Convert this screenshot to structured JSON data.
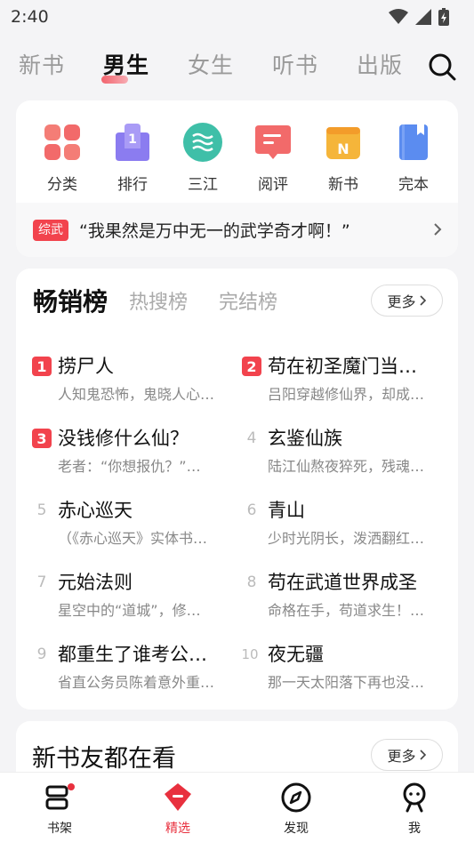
{
  "status": {
    "time": "2:40"
  },
  "top_tabs": [
    {
      "label": "新书"
    },
    {
      "label": "男生"
    },
    {
      "label": "女生"
    },
    {
      "label": "听书"
    },
    {
      "label": "出版"
    }
  ],
  "categories": [
    {
      "label": "分类",
      "icon": "grid-icon",
      "color": "#f26a6a"
    },
    {
      "label": "排行",
      "icon": "rank-icon",
      "color": "#8b7cf0"
    },
    {
      "label": "三江",
      "icon": "river-icon",
      "color": "#3fbfa8"
    },
    {
      "label": "阅评",
      "icon": "comment-icon",
      "color": "#f26a6a"
    },
    {
      "label": "新书",
      "icon": "new-book-icon",
      "color": "#f5b53a"
    },
    {
      "label": "完本",
      "icon": "finished-book-icon",
      "color": "#5b8cf0"
    }
  ],
  "quote": {
    "badge": "综武",
    "text": "“我果然是万中无一的武学奇才啊！”"
  },
  "ranking": {
    "tabs": [
      {
        "label": "畅销榜"
      },
      {
        "label": "热搜榜"
      },
      {
        "label": "完结榜"
      }
    ],
    "more_label": "更多",
    "items": [
      {
        "rank": "1",
        "title": "捞尸人",
        "desc": "人知鬼恐怖，鬼晓人心…"
      },
      {
        "rank": "2",
        "title": "苟在初圣魔门当…",
        "desc": "吕阳穿越修仙界，却成…"
      },
      {
        "rank": "3",
        "title": "没钱修什么仙？",
        "desc": "老者：“你想报仇？”…"
      },
      {
        "rank": "4",
        "title": "玄鉴仙族",
        "desc": "陆江仙熬夜猝死，残魂…"
      },
      {
        "rank": "5",
        "title": "赤心巡天",
        "desc": "（《赤心巡天》实体书…"
      },
      {
        "rank": "6",
        "title": "青山",
        "desc": "少时光阴长，泼洒翻红…"
      },
      {
        "rank": "7",
        "title": "元始法则",
        "desc": "星空中的“道城”，修…"
      },
      {
        "rank": "8",
        "title": "苟在武道世界成圣",
        "desc": "命格在手，苟道求生！…"
      },
      {
        "rank": "9",
        "title": "都重生了谁考公…",
        "desc": "省直公务员陈着意外重…"
      },
      {
        "rank": "10",
        "title": "夜无疆",
        "desc": "那一天太阳落下再也没…"
      }
    ]
  },
  "friends": {
    "title": "新书友都在看",
    "more_label": "更多"
  },
  "bottom_nav": [
    {
      "label": "书架",
      "icon": "bookshelf-icon"
    },
    {
      "label": "精选",
      "icon": "featured-icon"
    },
    {
      "label": "发现",
      "icon": "compass-icon"
    },
    {
      "label": "我",
      "icon": "profile-icon"
    }
  ],
  "colors": {
    "accent": "#e8303e",
    "rank_badge": "#f2434d"
  }
}
